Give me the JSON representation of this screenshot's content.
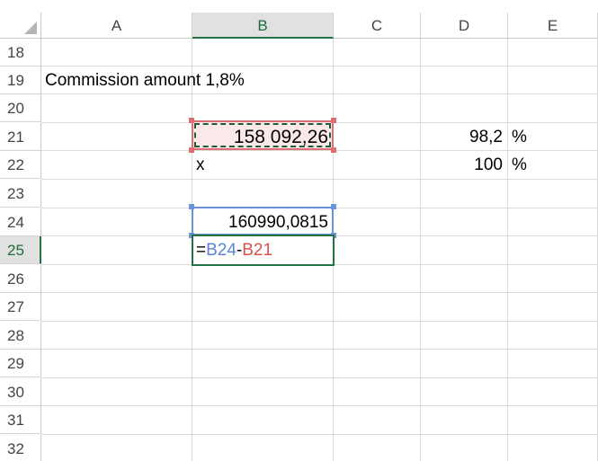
{
  "columns": [
    "A",
    "B",
    "C",
    "D",
    "E"
  ],
  "selected_column": "B",
  "rows": [
    "18",
    "19",
    "20",
    "21",
    "22",
    "23",
    "24",
    "25",
    "26",
    "27",
    "28",
    "29",
    "30",
    "31",
    "32"
  ],
  "selected_row": "25",
  "cells": {
    "A19": "Commission amount 1,8%",
    "B21": "158 092,26",
    "D21": "98,2",
    "E21": "%",
    "B22": "x",
    "D22": "100",
    "E22": "%",
    "B24": "160990,0815"
  },
  "active_cell": {
    "address": "B25",
    "formula_prefix": "=",
    "ref1": "B24",
    "operator": "-",
    "ref2": "B21"
  },
  "colors": {
    "accent_green": "#217346",
    "ref_blue": "#6b93dc",
    "ref_red": "#e06d72"
  }
}
